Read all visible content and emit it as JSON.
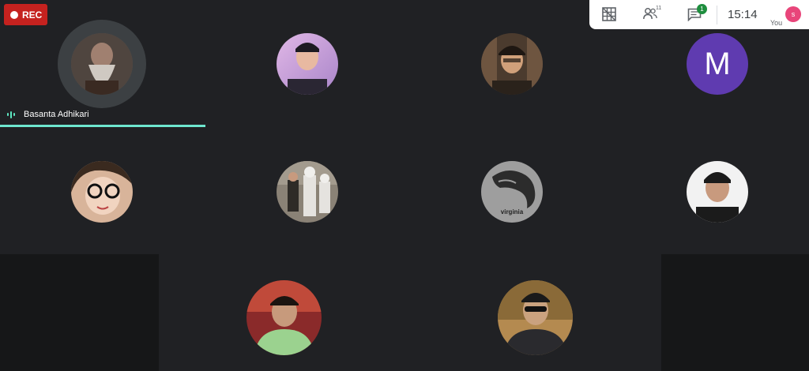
{
  "recording": {
    "label": "REC"
  },
  "active_speaker": {
    "name": "Basanta Adhikari"
  },
  "participants": [
    {
      "id": "p1",
      "kind": "photo",
      "colors": [
        "#6b5a52",
        "#c8c2bb",
        "#2b2624"
      ]
    },
    {
      "id": "p2",
      "kind": "photo",
      "colors": [
        "#c9a6d6",
        "#e8b9a1",
        "#2a2633"
      ]
    },
    {
      "id": "p3",
      "kind": "photo",
      "colors": [
        "#4b3b2e",
        "#d0a07a",
        "#1e1712"
      ]
    },
    {
      "id": "p4",
      "kind": "initial",
      "initial": "M",
      "color": "#5f3bb0"
    },
    {
      "id": "p5",
      "kind": "photo",
      "colors": [
        "#e8c2a7",
        "#f1d4c0",
        "#3a2a1f"
      ]
    },
    {
      "id": "p6",
      "kind": "photo",
      "colors": [
        "#8a8276",
        "#e5e3df",
        "#2e2b27"
      ]
    },
    {
      "id": "p7",
      "kind": "logo",
      "text": "virginia",
      "color": "#9e9e9e"
    },
    {
      "id": "p8",
      "kind": "photo",
      "colors": [
        "#f2f2f2",
        "#c89a7e",
        "#1b1b1b"
      ]
    },
    {
      "id": "p9",
      "kind": "photo",
      "colors": [
        "#8a2a2a",
        "#9bd28f",
        "#c79a7c"
      ]
    },
    {
      "id": "p10",
      "kind": "photo",
      "colors": [
        "#b48a50",
        "#caa27f",
        "#2a2a2e"
      ]
    }
  ],
  "toolbar": {
    "people_count": "11",
    "chat_badge": "1",
    "time": "15:14",
    "you_initial": "s",
    "you_label": "You"
  },
  "icons": [
    "grid-layout-icon",
    "people-icon",
    "chat-icon",
    "recording-dot-icon",
    "audio-level-icon"
  ]
}
